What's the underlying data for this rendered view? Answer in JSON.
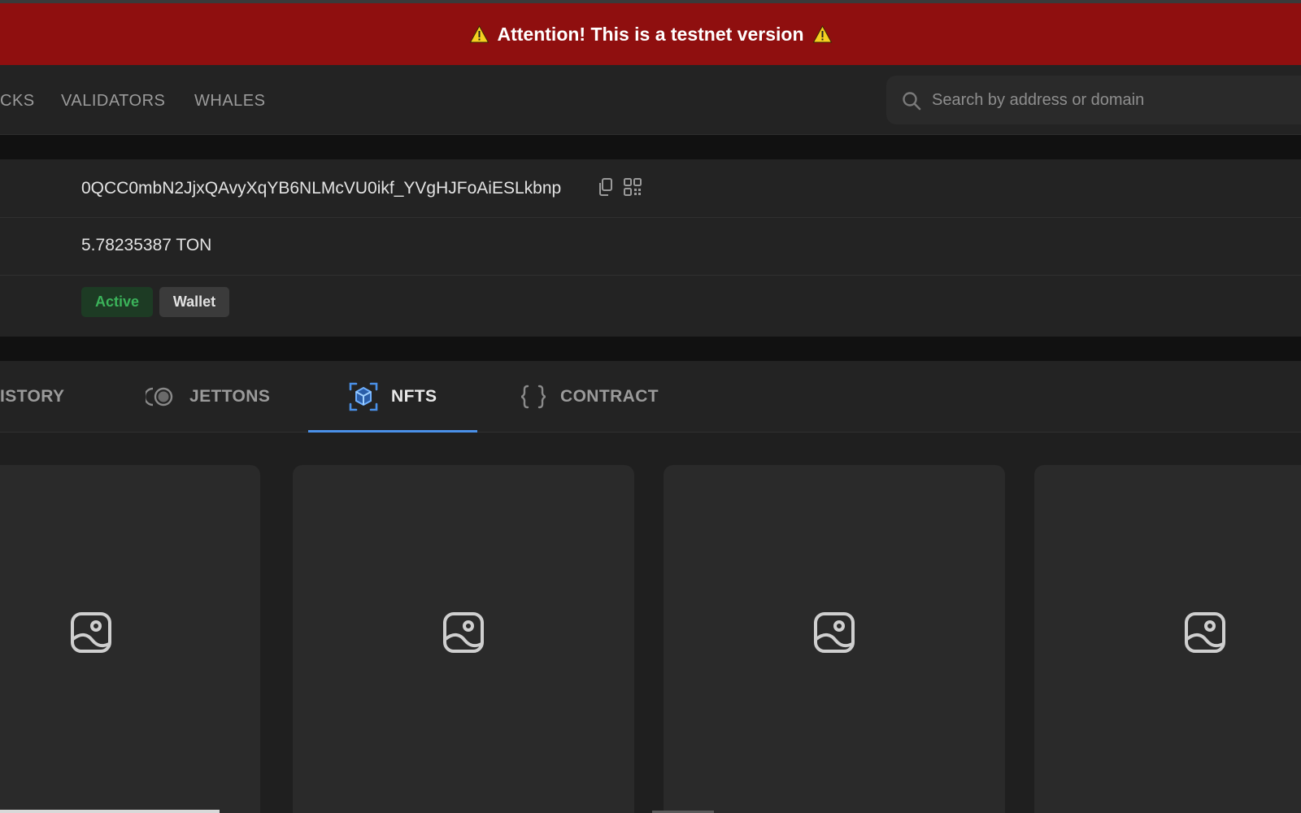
{
  "banner": {
    "message": "Attention! This is a testnet version",
    "icon": "warning-icon",
    "background": "#8f0f0f"
  },
  "nav": {
    "items": [
      {
        "label": "CKS"
      },
      {
        "label": "VALIDATORS"
      },
      {
        "label": "WHALES"
      }
    ]
  },
  "search": {
    "placeholder": "Search by address or domain",
    "value": ""
  },
  "account": {
    "address": "0QCC0mbN2JjxQAvyXqYB6NLMcVU0ikf_YVgHJFoAiESLkbnp",
    "balance": "5.78235387 TON",
    "status_badge": "Active",
    "type_badge": "Wallet"
  },
  "tabs": [
    {
      "label": "ISTORY",
      "icon": "history-icon",
      "active": false
    },
    {
      "label": "JETTONS",
      "icon": "jettons-icon",
      "active": false
    },
    {
      "label": "NFTS",
      "icon": "nft-cube-icon",
      "active": true
    },
    {
      "label": "CONTRACT",
      "icon": "braces-icon",
      "active": false
    }
  ],
  "nft_cards": [
    {
      "icon": "image-placeholder-icon"
    },
    {
      "icon": "image-placeholder-icon"
    },
    {
      "icon": "image-placeholder-icon"
    },
    {
      "icon": "image-placeholder-icon"
    }
  ],
  "colors": {
    "accent": "#4a90e8",
    "active_green": "#3bb35a",
    "background": "#1f1f1f",
    "panel": "#232323"
  }
}
